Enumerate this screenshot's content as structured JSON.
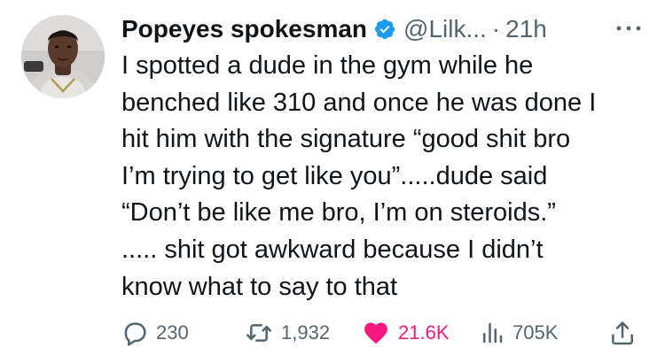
{
  "tweet": {
    "author": {
      "display_name": "Popeyes spokesman",
      "handle": "@Lilk...",
      "verified": true,
      "avatar_icon": "profile-photo"
    },
    "separator": "·",
    "timestamp": "21h",
    "text_lines": [
      "I spotted a dude in the gym while he",
      "benched like 310 and once he was done I",
      "hit him with the signature “good shit bro",
      "I’m trying to get like you”.....dude said",
      "“Don’t be like me bro, I’m on steroids.”",
      "..... shit got awkward because I didn’t",
      "know what to say to that"
    ],
    "metrics": {
      "replies": "230",
      "retweets": "1,932",
      "likes": "21.6K",
      "views": "705K"
    }
  },
  "icons": {
    "more": "more-icon",
    "reply": "reply-icon",
    "retweet": "retweet-icon",
    "like": "heart-icon",
    "views": "views-icon",
    "share": "share-icon",
    "verified": "verified-badge-icon"
  },
  "colors": {
    "verified": "#1d9bf0",
    "like": "#f91880",
    "muted": "#536471",
    "text": "#0f1419"
  }
}
